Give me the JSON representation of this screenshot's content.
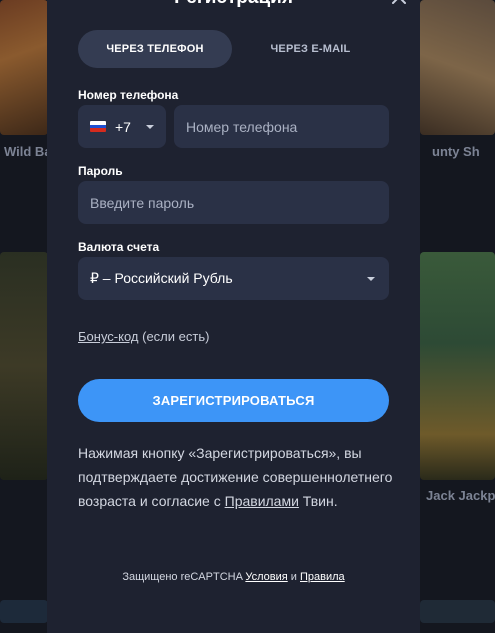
{
  "background": {
    "captions": [
      "Wild Ba",
      "unty Sh",
      "Jack Jackp"
    ]
  },
  "modal": {
    "title": "Регистрация",
    "close_icon": "close-icon"
  },
  "tabs": {
    "phone": "ЧЕРЕЗ ТЕЛЕФОН",
    "email": "ЧЕРЕЗ E-MAIL",
    "active": "phone"
  },
  "phone": {
    "label": "Номер телефона",
    "country_code": "+7",
    "country_flag": "russia-flag-icon",
    "placeholder": "Номер телефона"
  },
  "password": {
    "label": "Пароль",
    "placeholder": "Введите пароль"
  },
  "currency": {
    "label": "Валюта счета",
    "value": "₽ – Российский Рубль"
  },
  "bonus": {
    "link": "Бонус-код",
    "suffix": " (если есть)"
  },
  "submit_label": "ЗАРЕГИСТРИРОВАТЬСЯ",
  "terms": {
    "text": "Нажимая кнопку «Зарегистрироваться», вы подтверждаете достижение совершеннолетнего возраста и согласие с ",
    "link": "Правилами",
    "suffix": " Твин."
  },
  "recaptcha": {
    "text": "Защищено reCAPTCHA ",
    "terms_link": "Условия",
    "and": " и ",
    "privacy_link": "Правила"
  },
  "colors": {
    "accent": "#3d95f7",
    "modal_bg": "#1e2230",
    "field_bg": "#2a3146",
    "tab_active_bg": "#343c52"
  }
}
